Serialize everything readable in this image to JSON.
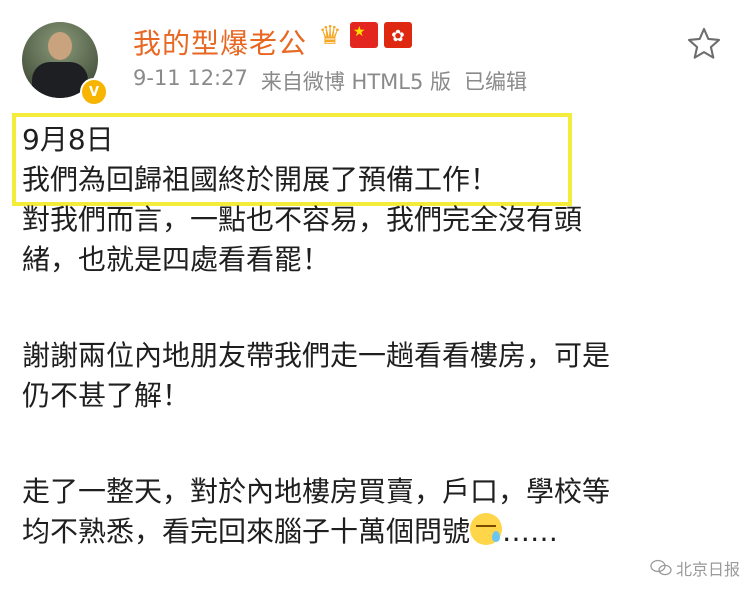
{
  "post_header": {
    "username": "我的型爆老公",
    "timestamp": "9-11 12:27",
    "source": "来自微博 HTML5 版",
    "edited_label": "已编辑",
    "verified_badge": "V",
    "badge_icons": [
      "crown-icon",
      "china-flag-icon",
      "hong-kong-flag-icon"
    ]
  },
  "post_body": {
    "highlighted_lines": [
      "9月8日",
      "我們為回歸祖國終於開展了預備工作！"
    ],
    "paragraph_1": [
      "對我們而言，一點也不容易，我們完全沒有頭",
      "緒，也就是四處看看罷！"
    ],
    "paragraph_2": [
      "謝謝兩位內地朋友帶我們走一趟看看樓房，可是",
      "仍不甚了解！"
    ],
    "paragraph_3": [
      "走了一整天，對於內地樓房買賣，戶口，學校等",
      "均不熟悉，看完回來腦子十萬個問號"
    ],
    "trailing_ellipsis": "……"
  },
  "watermark": {
    "text": "北京日报"
  },
  "colors": {
    "username": "#e86722",
    "meta": "#8a8a8a",
    "highlight_border": "#f4ec3b",
    "text": "#1f1f1f"
  }
}
